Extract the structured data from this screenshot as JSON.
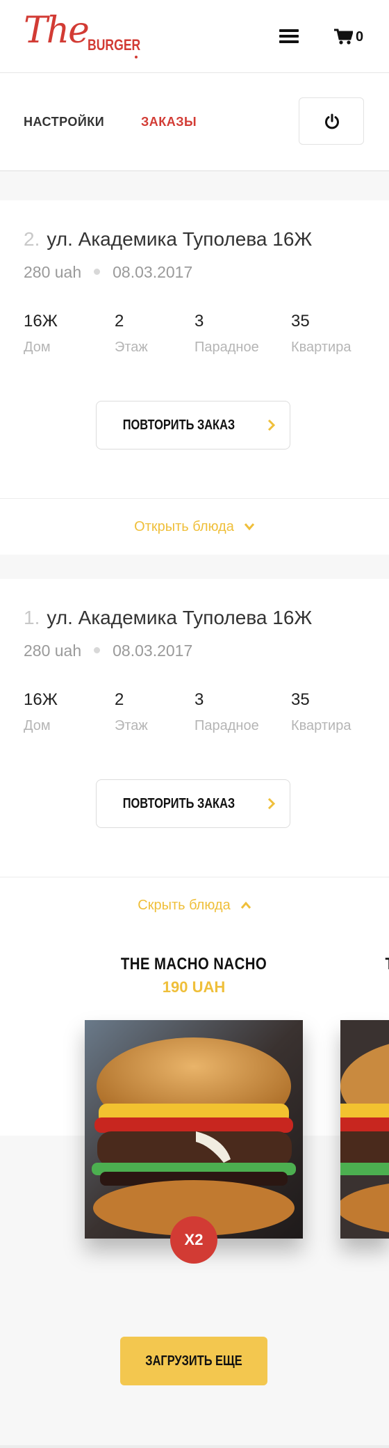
{
  "header": {
    "logo_script": "The",
    "logo_brand": "BURGER",
    "cart_count": "0"
  },
  "tabs": {
    "settings": "НАСТРОЙКИ",
    "orders": "ЗАКАЗЫ"
  },
  "orders": [
    {
      "number": "2.",
      "address": "ул. Академика Туполева 16Ж",
      "price": "280 uah",
      "date": "08.03.2017",
      "details": [
        {
          "value": "16Ж",
          "label": "Дом"
        },
        {
          "value": "2",
          "label": "Этаж"
        },
        {
          "value": "3",
          "label": "Парадное"
        },
        {
          "value": "35",
          "label": "Квартира"
        }
      ],
      "repeat_label": "ПОВТОРИТЬ ЗАКАЗ",
      "toggle_label": "Открыть блюда"
    },
    {
      "number": "1.",
      "address": "ул. Академика Туполева 16Ж",
      "price": "280 uah",
      "date": "08.03.2017",
      "details": [
        {
          "value": "16Ж",
          "label": "Дом"
        },
        {
          "value": "2",
          "label": "Этаж"
        },
        {
          "value": "3",
          "label": "Парадное"
        },
        {
          "value": "35",
          "label": "Квартира"
        }
      ],
      "repeat_label": "ПОВТОРИТЬ ЗАКАЗ",
      "toggle_label": "Скрыть блюда",
      "dishes": [
        {
          "name": "THE MACHO NACHO",
          "price": "190 UAH",
          "qty": "X2"
        },
        {
          "name": "T",
          "price": "",
          "qty": ""
        }
      ]
    }
  ],
  "load_more": "ЗАГРУЗИТЬ ЕЩЕ",
  "colors": {
    "accent_red": "#d23b34",
    "accent_yellow": "#efbf3a"
  }
}
